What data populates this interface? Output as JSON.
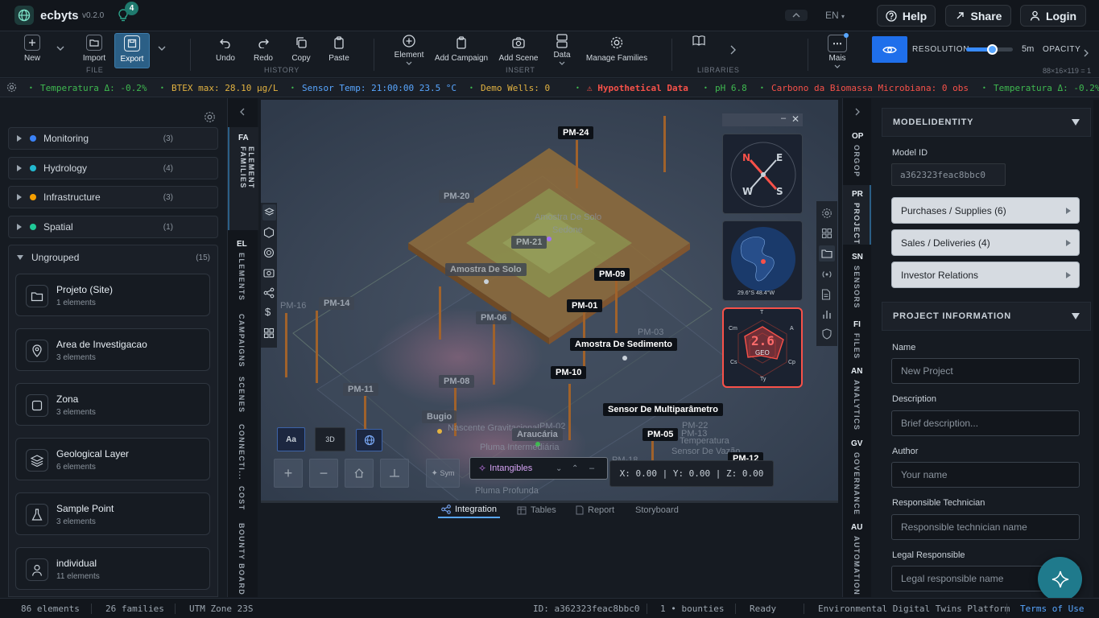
{
  "app": {
    "name": "ecbyts",
    "version": "v0.2.0",
    "notifications": "4",
    "language": "EN"
  },
  "header_buttons": {
    "help": "Help",
    "share": "Share",
    "login": "Login"
  },
  "ribbon": {
    "file": {
      "label": "FILE",
      "new": "New",
      "import": "Import",
      "export": "Export"
    },
    "history": {
      "label": "HISTORY",
      "undo": "Undo",
      "redo": "Redo",
      "copy": "Copy",
      "paste": "Paste"
    },
    "insert": {
      "label": "INSERT",
      "element": "Element",
      "add_campaign": "Add Campaign",
      "add_scene": "Add Scene",
      "data": "Data",
      "manage_families": "Manage Families"
    },
    "libraries": {
      "label": "LIBRARIES"
    },
    "more": {
      "label": "Mais"
    },
    "resolution": {
      "label": "RESOLUTION",
      "value": "5m",
      "fraction": 0.55,
      "grid": "88×16×119 = 1"
    },
    "opacity": {
      "label": "OPACITY"
    }
  },
  "ticker": [
    {
      "text": "Temperatura Δ: -0.2%",
      "color": "#3fb950"
    },
    {
      "text": "BTEX max: 28.10 μg/L",
      "color": "#e3b341"
    },
    {
      "text": "Sensor Temp: 21:00:00 23.5 °C",
      "color": "#58a6ff"
    },
    {
      "text": "Demo Wells: 0",
      "color": "#e3b341"
    },
    {
      "text": "⚠ Hypothetical Data",
      "color": "#f85149"
    },
    {
      "text": "pH 6.8",
      "color": "#3fb950"
    },
    {
      "text": "Carbono da Biomassa Microbiana: 0 obs",
      "color": "#f85149"
    },
    {
      "text": "Temperatura Δ: -0.2%",
      "color": "#3fb950"
    }
  ],
  "families": [
    {
      "name": "Monitoring",
      "count": "(3)",
      "color": "#3b82f6"
    },
    {
      "name": "Hydrology",
      "count": "(4)",
      "color": "#22b8cf"
    },
    {
      "name": "Infrastructure",
      "count": "(3)",
      "color": "#f59f00"
    },
    {
      "name": "Spatial",
      "count": "(1)",
      "color": "#20c997"
    }
  ],
  "ungrouped": {
    "name": "Ungrouped",
    "count": "(15)"
  },
  "elements": [
    {
      "title": "Projeto (Site)",
      "sub": "1 elements",
      "icon": "folder-icon"
    },
    {
      "title": "Area de Investigacao",
      "sub": "3 elements",
      "icon": "map-pin-icon"
    },
    {
      "title": "Zona",
      "sub": "3 elements",
      "icon": "square-icon"
    },
    {
      "title": "Geological Layer",
      "sub": "6 elements",
      "icon": "layers-icon"
    },
    {
      "title": "Sample Point",
      "sub": "3 elements",
      "icon": "flask-icon"
    },
    {
      "title": "individual",
      "sub": "11 elements",
      "icon": "person-icon"
    }
  ],
  "left_tabs": [
    {
      "abbr": "FA",
      "label": "ELEMENT FAMILIES"
    },
    {
      "abbr": "EL",
      "label": "ELEMENTS"
    },
    {
      "abbr": "",
      "label": "CAMPAIGNS"
    },
    {
      "abbr": "",
      "label": "SCENES"
    },
    {
      "abbr": "",
      "label": "CONNECTI..."
    },
    {
      "abbr": "",
      "label": "COST"
    },
    {
      "abbr": "",
      "label": "BOUNTY BOARD"
    }
  ],
  "right_tabs": [
    {
      "abbr": "OP",
      "label": "ORGOP"
    },
    {
      "abbr": "PR",
      "label": "PROJECT"
    },
    {
      "abbr": "SN",
      "label": "SENSORS"
    },
    {
      "abbr": "FI",
      "label": "FILES"
    },
    {
      "abbr": "AN",
      "label": "ANALYTICS"
    },
    {
      "abbr": "GV",
      "label": "GOVERNANCE"
    },
    {
      "abbr": "AU",
      "label": "AUTOMATION"
    }
  ],
  "viewport": {
    "labels_dark": [
      "PM-24",
      "PM-09",
      "PM-01",
      "Amostra De Sedimento",
      "PM-10",
      "Sensor De Multiparâmetro",
      "PM-05",
      "PM-12"
    ],
    "labels_grey": [
      "PM-20",
      "PM-21",
      "Amostra De Solo",
      "PM-14",
      "PM-06",
      "PM-08",
      "PM-11",
      "Bugio",
      "Araucária"
    ],
    "labels_faint": [
      "Amostra De Solo",
      "Sedone",
      "PM-16",
      "PM-03",
      "Nascente Gravitacional",
      "PM-02",
      "Pluma Intermediária",
      "PM-22",
      "Temperatura",
      "Sensor De Vazão",
      "PM-13",
      "Pluma Profunda",
      "PM-18"
    ],
    "view_buttons": {
      "text_toggle": "Aa",
      "mode_3d": "3D",
      "sym": "Sym"
    },
    "intangibles": "Intangibles",
    "coords": "X: 0.00 | Y: 0.00 | Z: 0.00",
    "radar": {
      "value": "2.6",
      "sub": "GEO",
      "axes": [
        "T",
        "A",
        "Cp",
        "Ty",
        "Cs",
        "Cm"
      ]
    },
    "globe_coords": "29.6°S  48.4°W"
  },
  "bottom_tabs": [
    {
      "label": "Integration",
      "active": true
    },
    {
      "label": "Tables",
      "active": false
    },
    {
      "label": "Report",
      "active": false
    },
    {
      "label": "Storyboard",
      "active": false
    }
  ],
  "right_panel": {
    "model_identity": {
      "header": "MODELIDENTITY",
      "id_label": "Model ID",
      "id_value": "a362323feac8bbc0"
    },
    "accordions": [
      "Purchases / Supplies (6)",
      "Sales / Deliveries (4)",
      "Investor Relations"
    ],
    "project_info": {
      "header": "PROJECT INFORMATION",
      "fields": [
        {
          "label": "Name",
          "placeholder": "New Project"
        },
        {
          "label": "Description",
          "placeholder": "Brief description..."
        },
        {
          "label": "Author",
          "placeholder": "Your name"
        },
        {
          "label": "Responsible Technician",
          "placeholder": "Responsible technician name"
        },
        {
          "label": "Legal Responsible",
          "placeholder": "Legal responsible name"
        }
      ]
    }
  },
  "status": {
    "elements": "86 elements",
    "families": "26 families",
    "utm": "UTM Zone 23S",
    "id": "ID: a362323feac8bbc0",
    "bounties": "1 • bounties",
    "ready": "Ready",
    "platform": "Environmental Digital Twins Platform",
    "terms": "Terms of Use"
  },
  "colors": {
    "accent": "#1f6feb",
    "teal": "#1f7a6e",
    "terrain": "#a0622b"
  }
}
